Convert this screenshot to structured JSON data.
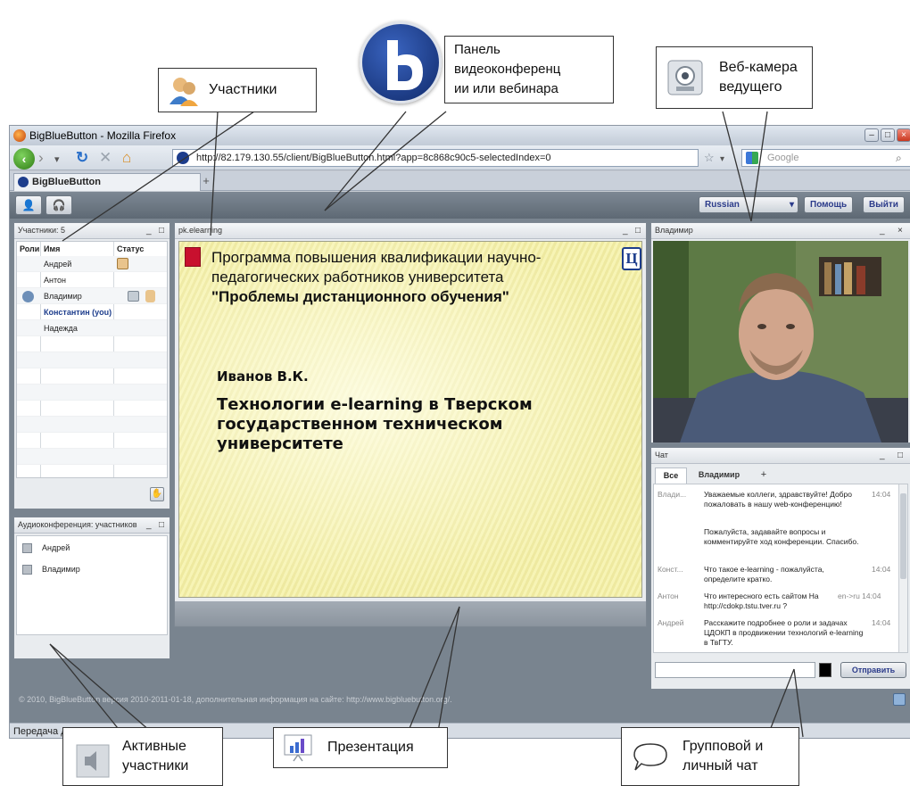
{
  "window_title": "BigBlueButton - Mozilla Firefox",
  "url": "http://82.179.130.55/client/BigBlueButton.html?app=8c868c90c5-selectedIndex=0",
  "search_placeholder": "Google",
  "tab_label": "BigBlueButton",
  "tab_new": "+",
  "toolbar": {
    "language": "Russian",
    "help": "Помощь",
    "logout": "Выйти"
  },
  "participants": {
    "title": "Участники: 5",
    "col_role": "Роли",
    "col_name": "Имя",
    "col_status": "Статус",
    "rows": [
      "Андрей",
      "Антон",
      "Владимир",
      "Константин (you)",
      "Надежда"
    ]
  },
  "audio": {
    "title": "Аудиоконференция: участников",
    "rows": [
      "Андрей",
      "Владимир"
    ]
  },
  "presentation": {
    "title": "pk.elearning",
    "line1": "Программа повышения квалификации научно-",
    "line2": "педагогических работников университета",
    "line3": "\"Проблемы дистанционного обучения\"",
    "author": "Иванов В.К.",
    "topic1": "Технологии e-learning в Тверском",
    "topic2": "государственном техническом",
    "topic3": "университете",
    "logo_letter": "Ц"
  },
  "webcam": {
    "title": "Владимир"
  },
  "chat": {
    "title": "Чат",
    "tab_all": "Все",
    "tab_user": "Владимир",
    "tab_plus": "+",
    "messages": [
      {
        "name": "Влади...",
        "text": "Уважаемые коллеги, здравствуйте! Добро пожаловать в нашу web-конференцию!",
        "time": "14:04"
      },
      {
        "name": "",
        "text": "Пожалуйста, задавайте вопросы и комментируйте ход конференции. Спасибо.",
        "time": ""
      },
      {
        "name": "Конст...",
        "text": "Что такое e-learning - пожалуйста, определите кратко.",
        "time": "14:04"
      },
      {
        "name": "Антон",
        "text": "Что интересного есть сайтом На http://cdokp.tstu.tver.ru ?",
        "time": "en->ru 14:04"
      },
      {
        "name": "Андрей",
        "text": "Расскажите подробнее о роли и задачах ЦДОКП в продвижении технологий e-learning в ТвГТУ.",
        "time": "14:04"
      }
    ],
    "send": "Отправить"
  },
  "footer": "© 2010, BigBlueButton версия 2010-2011-01-18, дополнительная информация на сайте: http://www.bigbluebutton.org/.",
  "statusbar": "Передача данных 82.179.130.55...",
  "callouts": {
    "participants": "Участники",
    "conference": [
      "Панель",
      "видеоконференц",
      "ии или вебинара"
    ],
    "webcam": [
      "Веб-камера",
      "ведущего"
    ],
    "active": [
      "Активные",
      "участники"
    ],
    "presentation": "Презентация",
    "chat": [
      "Групповой и",
      "личный чат"
    ]
  },
  "colors": {
    "accent": "#1d3d8c",
    "toolbar": "#6b7681"
  }
}
